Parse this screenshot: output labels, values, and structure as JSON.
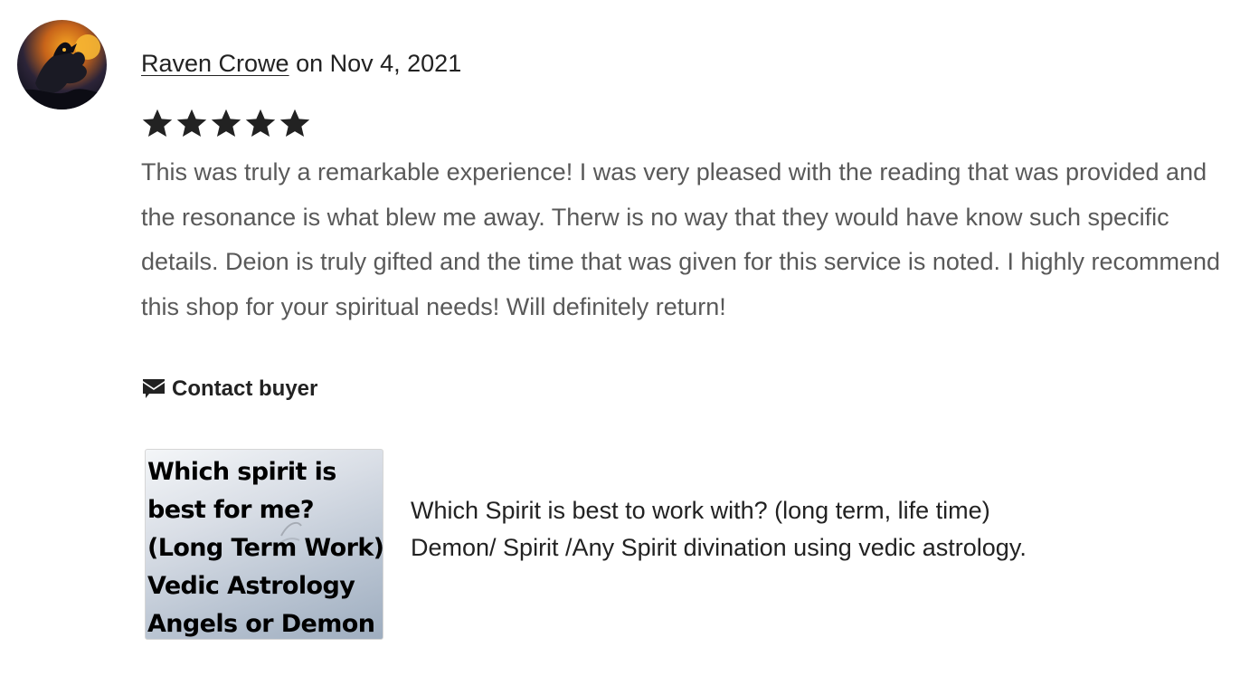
{
  "review": {
    "reviewer_name": "Raven Crowe",
    "date_text": " on Nov 4, 2021",
    "rating_stars": 5,
    "rating_max": 5,
    "body": "This was truly a remarkable experience! I was very pleased with the reading that was provided and the resonance is what blew me away. Therw is no way that they would have know such specific details. Deion is truly gifted and the time that was given for this service is noted. I highly recommend this shop for your spiritual needs! Will definitely return!"
  },
  "actions": {
    "contact_label": "Contact buyer",
    "contact_icon": "envelope-icon"
  },
  "listing": {
    "thumbnail_text": "Which spirit is\nbest for me?\n(Long Term Work)\nVedic Astrology\nAngels or Demon",
    "title": "Which Spirit is best to work with? (long term, life time) Demon/ Spirit /Any Spirit divination using vedic astrology."
  },
  "colors": {
    "text_primary": "#222222",
    "text_secondary": "#595959",
    "star": "#222222"
  }
}
